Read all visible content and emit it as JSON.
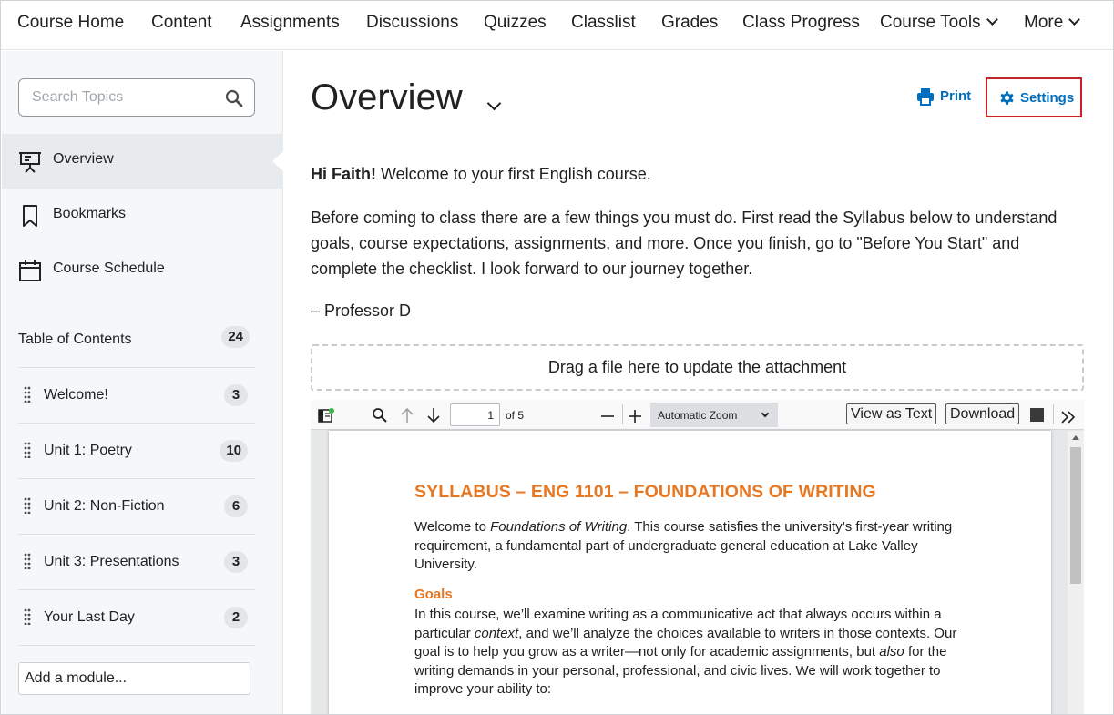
{
  "topnav": {
    "items": [
      {
        "label": "Course Home"
      },
      {
        "label": "Content"
      },
      {
        "label": "Assignments"
      },
      {
        "label": "Discussions"
      },
      {
        "label": "Quizzes"
      },
      {
        "label": "Classlist"
      },
      {
        "label": "Grades"
      },
      {
        "label": "Class Progress"
      },
      {
        "label": "Course Tools"
      },
      {
        "label": "More"
      }
    ]
  },
  "sidebar": {
    "search_placeholder": "Search Topics",
    "tools": [
      {
        "label": "Overview",
        "icon": "presentation-icon"
      },
      {
        "label": "Bookmarks",
        "icon": "bookmark-icon"
      },
      {
        "label": "Course Schedule",
        "icon": "calendar-icon"
      }
    ],
    "toc": {
      "label": "Table of Contents",
      "count": "24"
    },
    "modules": [
      {
        "label": "Welcome!",
        "count": "3"
      },
      {
        "label": "Unit 1: Poetry",
        "count": "10"
      },
      {
        "label": "Unit 2: Non-Fiction",
        "count": "6"
      },
      {
        "label": "Unit 3: Presentations",
        "count": "3"
      },
      {
        "label": "Your Last Day",
        "count": "2"
      }
    ],
    "add_module": "Add a module..."
  },
  "main": {
    "title": "Overview",
    "print_label": "Print",
    "settings_label": "Settings",
    "greeting_bold": "Hi Faith!",
    "greeting_rest": " Welcome to your first English course.",
    "paragraph": "Before coming to class there are a few things you must do. First read the Syllabus below to understand goals, course expectations, assignments, and more. Once you finish, go to \"Before You Start\" and complete the checklist. I look forward to our journey together.",
    "signature": "– Professor D",
    "dropzone": "Drag a file here to update the attachment"
  },
  "pdf_viewer": {
    "page_number": "1",
    "of_pages": "of 5",
    "zoom": "Automatic Zoom",
    "view_as_text": "View as Text",
    "download": "Download",
    "document": {
      "title": "SYLLABUS – ENG 1101 – FOUNDATIONS OF WRITING",
      "intro_a": "Welcome to ",
      "intro_italic": "Foundations of Writing",
      "intro_b": ". This course satisfies the university’s first-year writing requirement, a fundamental part of undergraduate general education at Lake Valley University.",
      "goals_heading": "Goals",
      "goals_a": "In this course, we’ll examine writing as a communicative act that always occurs within a particular ",
      "goals_italic1": "context",
      "goals_b": ", and we’ll analyze the choices available to writers in those contexts. Our goal is to help you grow as a writer—not only for academic assignments, but ",
      "goals_italic2": "also",
      "goals_c": " for the writing demands in your personal, professional, and civic lives. We will work together to improve your ability to:"
    }
  },
  "colors": {
    "link_blue": "#006fbf",
    "settings_border": "#cd2026",
    "syllabus_orange": "#e87722",
    "sidebar_bg": "#f6f7f8"
  }
}
